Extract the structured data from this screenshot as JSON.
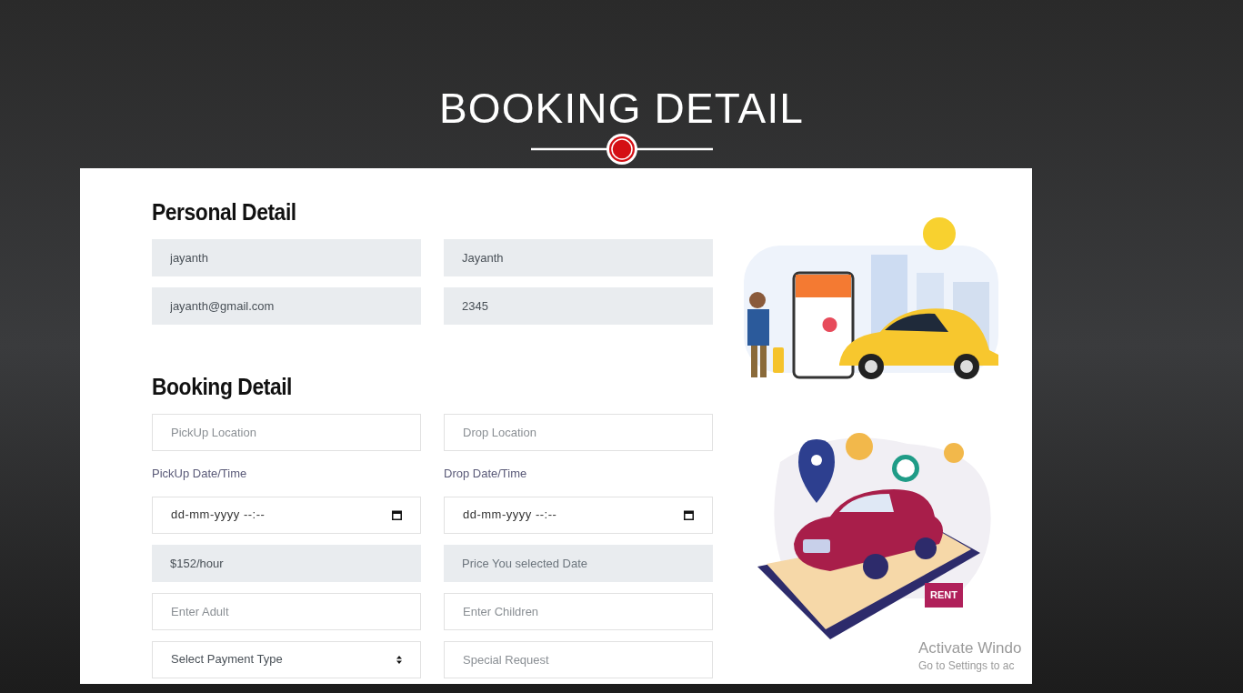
{
  "header": {
    "title": "BOOKING DETAIL"
  },
  "sections": [
    {
      "heading": "Personal Detail",
      "rows": [
        [
          {
            "kind": "readonly",
            "value": "jayanth"
          },
          {
            "kind": "readonly",
            "value": "Jayanth"
          }
        ],
        [
          {
            "kind": "readonly",
            "value": "jayanth@gmail.com"
          },
          {
            "kind": "readonly",
            "value": "2345"
          }
        ]
      ]
    },
    {
      "heading": "Booking Detail",
      "rows": [
        [
          {
            "kind": "input",
            "placeholder": "PickUp Location"
          },
          {
            "kind": "input",
            "placeholder": "Drop Location"
          }
        ],
        [
          {
            "kind": "label",
            "text": "PickUp Date/Time"
          },
          {
            "kind": "label",
            "text": "Drop Date/Time"
          }
        ],
        [
          {
            "kind": "datetime",
            "value": "dd-mm-yyyy --:--"
          },
          {
            "kind": "datetime",
            "value": "dd-mm-yyyy --:--"
          }
        ],
        [
          {
            "kind": "readonly",
            "value": "$152/hour"
          },
          {
            "kind": "readonly",
            "placeholder": "Price You selected Date"
          }
        ],
        [
          {
            "kind": "input",
            "placeholder": "Enter Adult"
          },
          {
            "kind": "input",
            "placeholder": "Enter Children"
          }
        ],
        [
          {
            "kind": "select",
            "value": "Select Payment Type"
          },
          {
            "kind": "input",
            "placeholder": "Special Request"
          }
        ]
      ]
    }
  ],
  "illustration_badge": "RENT",
  "activation_notice": {
    "title": "Activate Windo",
    "subtitle": "Go to Settings to ac"
  }
}
